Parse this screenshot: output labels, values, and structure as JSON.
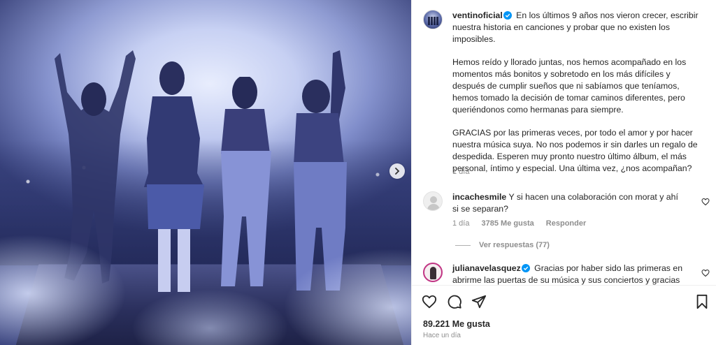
{
  "post": {
    "author": "ventinoficial",
    "caption_p1": "En los últimos 9 años nos vieron crecer, escribir nuestra historia en canciones y probar que no existen los imposibles.",
    "caption_p2": "Hemos reído y llorado juntas, nos hemos acompañado en los momentos más bonitos y sobretodo en los más difíciles y después de cumplir sueños que ni sabíamos que teníamos, hemos tomado la decisión de tomar caminos diferentes, pero queriéndonos como hermanas para siempre.",
    "caption_p3": "GRACIAS por las primeras veces, por todo el amor y por hacer nuestra música suya. No nos podemos ir sin darles un regalo de despedida. Esperen muy pronto nuestro último álbum, el más personal, íntimo y especial. Una última vez, ¿nos acompañan?",
    "caption_time": "1 día",
    "likes": "89.221 Me gusta",
    "posted": "Hace un día"
  },
  "comments": [
    {
      "username": "incachesmile",
      "text": "Y si hacen una colaboración con morat y ahí si se separan?",
      "time": "1 día",
      "likes": "3785 Me gusta",
      "reply_label": "Responder",
      "view_replies": "Ver respuestas (77)"
    },
    {
      "username": "julianavelasquez",
      "text": "Gracias por haber sido las primeras en abrirme las puertas de su música y sus conciertos y gracias por"
    }
  ],
  "icons": {
    "verified": "verified-badge-icon",
    "like": "heart-icon",
    "comment": "comment-icon",
    "share": "paper-plane-icon",
    "save": "bookmark-icon",
    "next": "chevron-right-icon"
  },
  "colors": {
    "verified": "#0095f6",
    "meta_text": "#8e8e8e",
    "text": "#262626"
  }
}
